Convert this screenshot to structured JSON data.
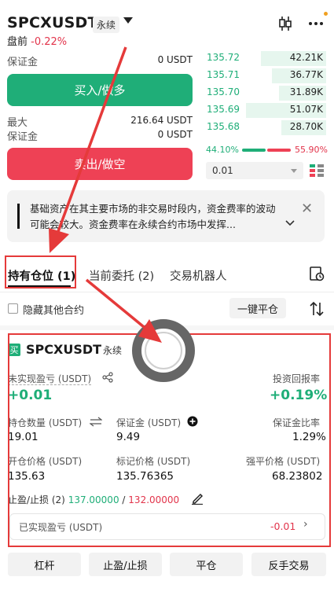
{
  "header": {
    "symbol": "SPCXUSDT",
    "tag": "永续",
    "premarket_label": "盘前",
    "premarket_change": "-0.22%"
  },
  "trade": {
    "margin_label": "保证金",
    "margin_value": "0 USDT",
    "buy_label": "买入/做多",
    "max_label": "最大",
    "max_value": "216.64 USDT",
    "margin2_label": "保证金",
    "margin2_value": "0 USDT",
    "sell_label": "卖出/做空"
  },
  "orderbook": {
    "bids": [
      {
        "price": "135.72",
        "size": "42.21K",
        "depth": 0.55
      },
      {
        "price": "135.71",
        "size": "36.77K",
        "depth": 0.46
      },
      {
        "price": "135.70",
        "size": "31.89K",
        "depth": 0.4
      },
      {
        "price": "135.69",
        "size": "51.07K",
        "depth": 0.68
      },
      {
        "price": "135.68",
        "size": "28.70K",
        "depth": 0.38
      }
    ],
    "buy_ratio": "44.10%",
    "sell_ratio": "55.90%",
    "precision": "0.01"
  },
  "notice": {
    "text": "基础资产在其主要市场的非交易时段内，资金费率的波动可能会较大。资金费率在永续合约市场中发挥..."
  },
  "tabs": {
    "positions": "持有仓位 (1)",
    "orders": "当前委托 (2)",
    "bots": "交易机器人"
  },
  "filter": {
    "hide_others": "隐藏其他合约",
    "close_all": "一键平仓"
  },
  "position": {
    "side": "买",
    "symbol": "SPCXUSDT",
    "tag": "永续",
    "unrealized_label": "未实现盈亏 (USDT)",
    "unrealized_value": "+0.01",
    "roi_label": "投资回报率",
    "roi_value": "+0.19%",
    "qty_label": "持仓数量 (USDT)",
    "qty_value": "19.01",
    "margin_label": "保证金 (USDT)",
    "margin_value": "9.49",
    "margin_ratio_label": "保证金比率",
    "margin_ratio_value": "1.29%",
    "entry_label": "开仓价格 (USDT)",
    "entry_value": "135.63",
    "mark_label": "标记价格 (USDT)",
    "mark_value": "135.76365",
    "liq_label": "强平价格 (USDT)",
    "liq_value": "68.23802",
    "tpsl_label": "止盈/止损 (2)",
    "tp_value": "137.00000",
    "sl_sep": "/",
    "sl_value": "132.00000",
    "realized_label": "已实现盈亏 (USDT)",
    "realized_value": "-0.01"
  },
  "actions": {
    "leverage": "杠杆",
    "tpsl": "止盈/止损",
    "close": "平仓",
    "reverse": "反手交易"
  },
  "colors": {
    "green": "#1fae78",
    "red": "#e2344b",
    "annotation": "#e53a3a"
  }
}
